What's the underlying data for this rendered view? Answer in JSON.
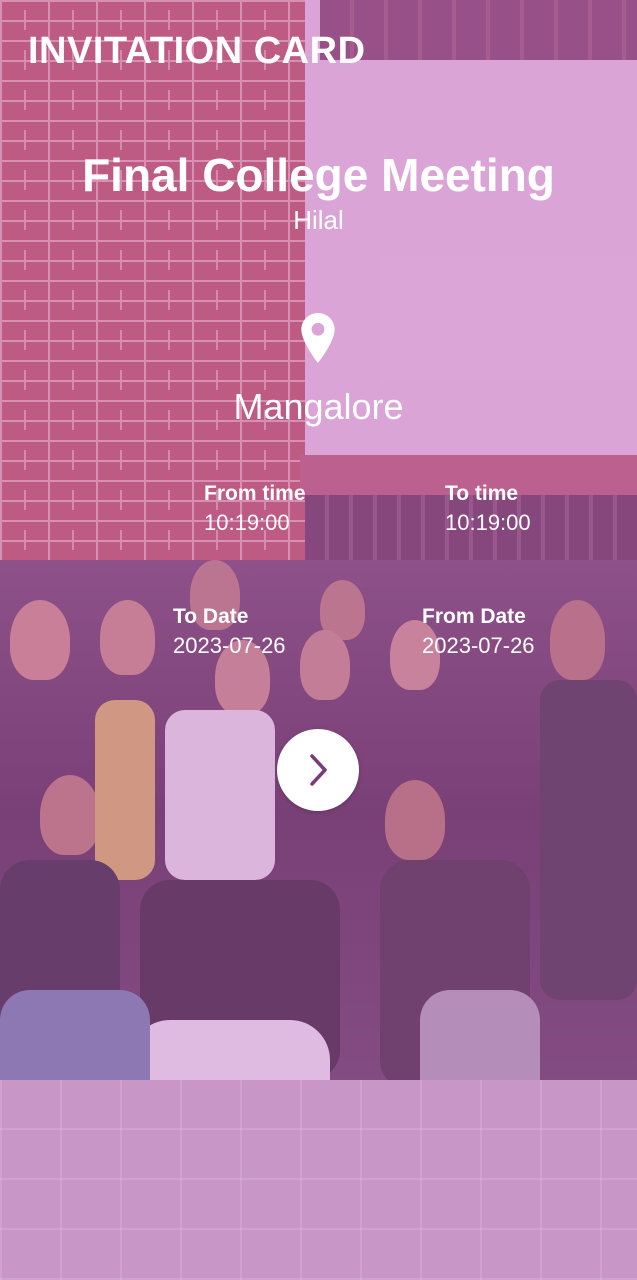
{
  "header": {
    "title": "INVITATION CARD"
  },
  "event": {
    "title": "Final College Meeting",
    "host": "Hilal",
    "location": "Mangalore"
  },
  "times": {
    "from_time_label": "From time",
    "from_time_value": "10:19:00",
    "to_time_label": "To time",
    "to_time_value": "10:19:00"
  },
  "dates": {
    "to_date_label": "To Date",
    "to_date_value": "2023-07-26",
    "from_date_label": "From Date",
    "from_date_value": "2023-07-26"
  },
  "icons": {
    "location": "map-pin-icon",
    "next": "chevron-right-icon"
  },
  "colors": {
    "overlay": "#c86ec8",
    "text": "#ffffff",
    "accent": "#7b3a78",
    "button_bg": "#ffffff"
  }
}
